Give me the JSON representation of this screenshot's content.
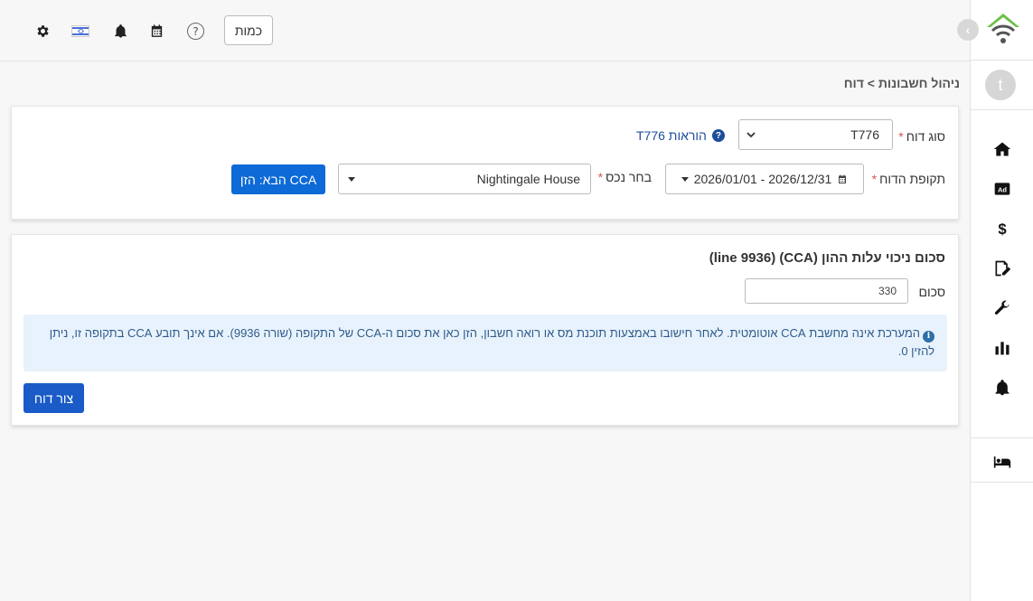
{
  "topbar": {
    "units_label": "כמות",
    "help_glyph": "?",
    "icons": [
      "gear-icon",
      "israel-flag-icon",
      "bell-icon",
      "calendar-icon",
      "help-circle-icon"
    ]
  },
  "sidebar": {
    "avatar_letter": "t",
    "collapse_glyph": "‹",
    "items": [
      "home-icon",
      "ad-icon",
      "dollar-icon",
      "document-edit-icon",
      "wrench-icon",
      "bar-chart-icon",
      "bell-icon",
      "bed-icon"
    ]
  },
  "breadcrumb": "ניהול חשבונות > דוח",
  "filters": {
    "report_type_label": "סוג דוח",
    "report_type_value": "T776",
    "instructions_link": "הוראות T776",
    "period_label": "תקופת הדוח",
    "period_value": "2026/01/01 - 2026/12/31",
    "property_label": "בחר נכס",
    "property_value": "Nightingale House",
    "next_button": "הבא: הזן CCA",
    "required_mark": "*"
  },
  "cca": {
    "title": "סכום ניכוי עלות ההון (CCA)   (line 9936)",
    "amount_label": "סכום",
    "amount_value": "330",
    "info_text": "המערכת אינה מחשבת CCA אוטומטית. לאחר חישובו באמצעות תוכנת מס או רואה חשבון, הזן כאן את סכום ה-CCA של התקופה (שורה 9936). אם אינך תובע CCA בתקופה זו, ניתן להזין 0.",
    "create_button": "צור דוח"
  },
  "colors": {
    "primary": "#0d6ad6",
    "link": "#1e4d9b",
    "required": "#d9534f",
    "info_bg": "#e8f2fc",
    "logo_green": "#6cc04a"
  }
}
